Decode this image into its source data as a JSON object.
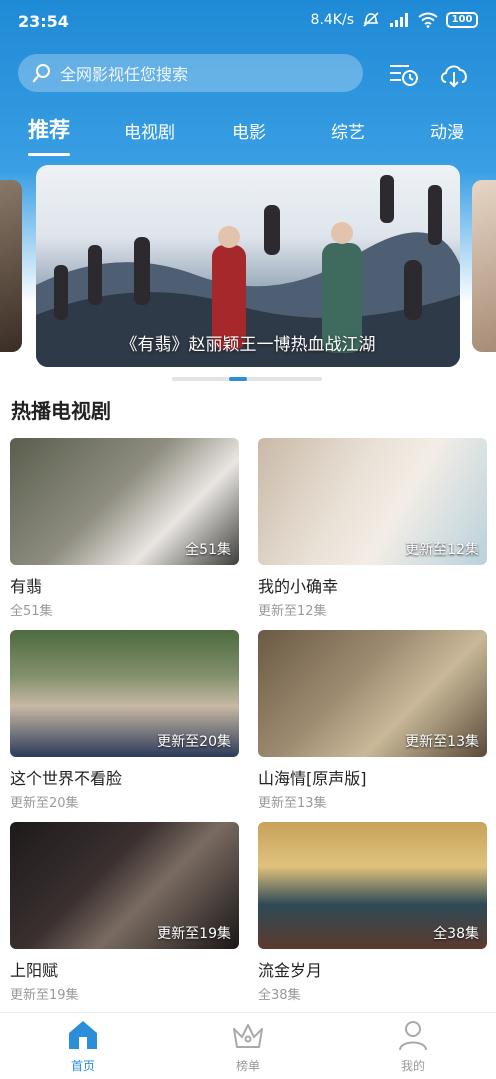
{
  "status_bar": {
    "time": "23:54",
    "speed": "8.4K/s",
    "battery": "100"
  },
  "header": {
    "search_placeholder": "全网影视任您搜索",
    "history_icon": "history-list-icon",
    "download_icon": "cloud-download-icon"
  },
  "tabs": [
    {
      "label": "推荐",
      "active": true
    },
    {
      "label": "电视剧"
    },
    {
      "label": "电影"
    },
    {
      "label": "综艺"
    },
    {
      "label": "动漫"
    }
  ],
  "banner": {
    "caption": "《有翡》赵丽颖王一博热血战江湖"
  },
  "section": {
    "title": "热播电视剧"
  },
  "dramas": [
    {
      "title": "有翡",
      "badge": "全51集",
      "subtitle": "全51集"
    },
    {
      "title": "我的小确幸",
      "badge": "更新至12集",
      "subtitle": "更新至12集"
    },
    {
      "title": "这个世界不看脸",
      "badge": "更新至20集",
      "subtitle": "更新至20集"
    },
    {
      "title": "山海情[原声版]",
      "badge": "更新至13集",
      "subtitle": "更新至13集"
    },
    {
      "title": "上阳赋",
      "badge": "更新至19集",
      "subtitle": "更新至19集"
    },
    {
      "title": "流金岁月",
      "badge": "全38集",
      "subtitle": "全38集"
    }
  ],
  "bottom_nav": [
    {
      "label": "首页",
      "icon": "home-icon",
      "active": true
    },
    {
      "label": "榜单",
      "icon": "crown-icon"
    },
    {
      "label": "我的",
      "icon": "user-icon"
    }
  ],
  "colors": {
    "accent": "#2a8fd8",
    "header_top": "#1f8ad6"
  }
}
